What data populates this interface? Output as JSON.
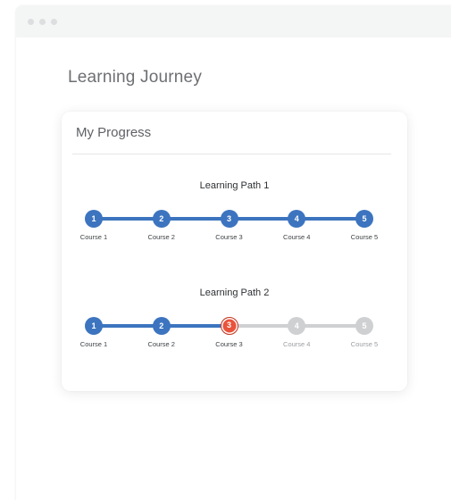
{
  "page": {
    "title": "Learning Journey"
  },
  "card": {
    "title": "My Progress"
  },
  "colors": {
    "completed": "#3c74bf",
    "current": "#e9533b",
    "current_ring": "#c23b26",
    "pending": "#cfd0d2",
    "line_completed": "#3c74bf",
    "line_pending": "#cfd0d2"
  },
  "paths": [
    {
      "title": "Learning Path 1",
      "nodes": [
        {
          "number": "1",
          "label": "Course 1",
          "status": "completed"
        },
        {
          "number": "2",
          "label": "Course 2",
          "status": "completed"
        },
        {
          "number": "3",
          "label": "Course 3",
          "status": "completed"
        },
        {
          "number": "4",
          "label": "Course 4",
          "status": "completed"
        },
        {
          "number": "5",
          "label": "Course 5",
          "status": "completed"
        }
      ]
    },
    {
      "title": "Learning Path 2",
      "nodes": [
        {
          "number": "1",
          "label": "Course 1",
          "status": "completed"
        },
        {
          "number": "2",
          "label": "Course 2",
          "status": "completed"
        },
        {
          "number": "3",
          "label": "Course 3",
          "status": "current"
        },
        {
          "number": "4",
          "label": "Course 4",
          "status": "pending"
        },
        {
          "number": "5",
          "label": "Course 5",
          "status": "pending"
        }
      ]
    }
  ]
}
